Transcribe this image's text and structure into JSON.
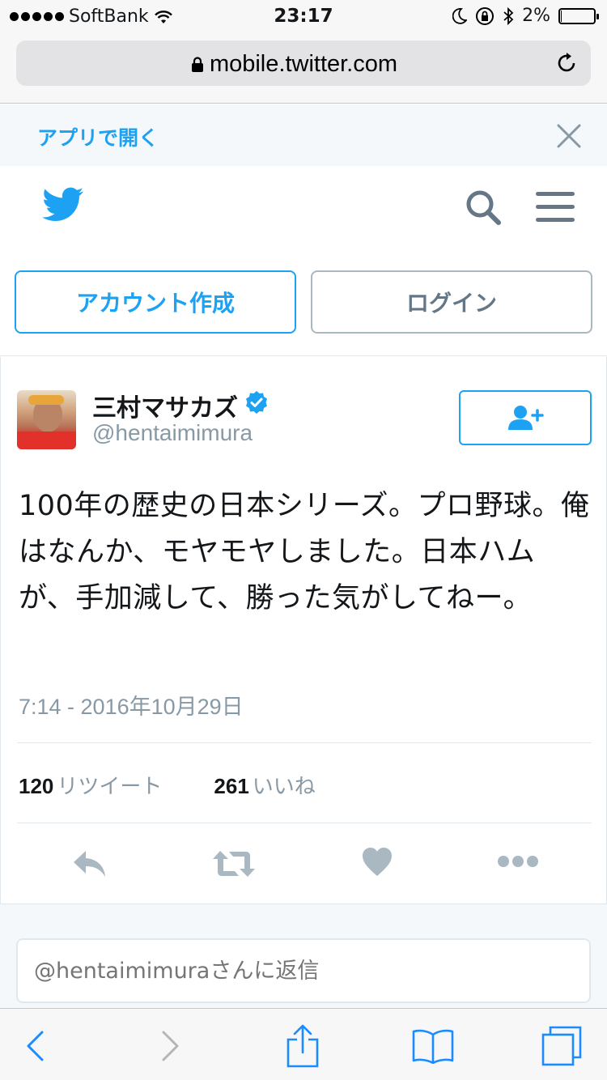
{
  "status_bar": {
    "carrier": "SoftBank",
    "time": "23:17",
    "battery": "2%",
    "battery_level": 0.02
  },
  "browser": {
    "url": "mobile.twitter.com"
  },
  "app_banner": {
    "label": "アプリで開く"
  },
  "auth": {
    "signup_label": "アカウント作成",
    "login_label": "ログイン"
  },
  "tweet": {
    "author_name": "三村マサカズ",
    "author_handle": "@hentaimimura",
    "text": "100年の歴史の日本シリーズ。プロ野球。俺はなんか、モヤモヤしました。日本ハムが、手加減して、勝った気がしてねー。",
    "timestamp": "7:14 - 2016年10月29日",
    "retweet_count": "120",
    "retweet_label": "リツイート",
    "like_count": "261",
    "like_label": "いいね"
  },
  "reply": {
    "placeholder": "@hentaimimuraさんに返信"
  },
  "colors": {
    "brand": "#1da1f2",
    "muted": "#8899a6",
    "action_icons": "#aab8c2"
  }
}
